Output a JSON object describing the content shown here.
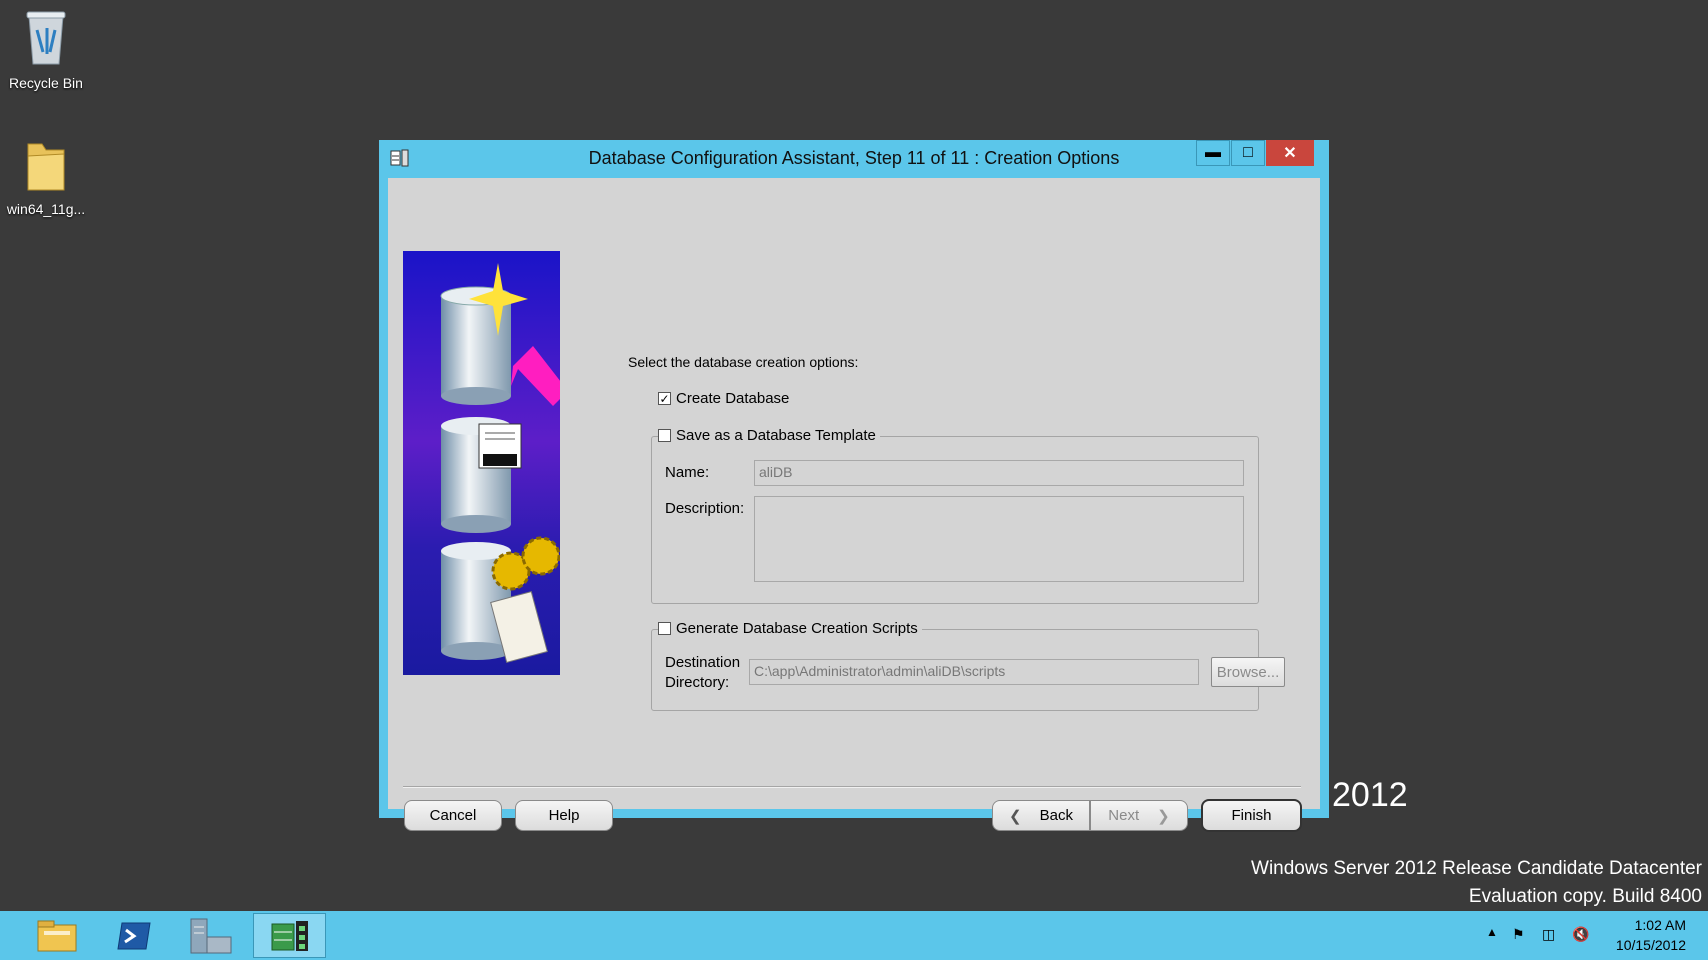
{
  "desktop": {
    "icons": [
      {
        "label": "Recycle Bin"
      },
      {
        "label": "win64_11g..."
      }
    ],
    "brand_year": "2012",
    "watermark_line1": "Windows Server 2012 Release Candidate Datacenter",
    "watermark_line2": "Evaluation copy. Build 8400"
  },
  "dialog": {
    "title": "Database Configuration Assistant, Step 11 of 11 : Creation Options",
    "prompt": "Select the database creation options:",
    "create_database": {
      "label": "Create Database",
      "checked": true
    },
    "save_template": {
      "label": "Save as a Database Template",
      "checked": false,
      "name_label": "Name:",
      "name_value": "aliDB",
      "description_label": "Description:",
      "description_value": ""
    },
    "generate_scripts": {
      "label": "Generate Database Creation Scripts",
      "checked": false,
      "destination_label_1": "Destination",
      "destination_label_2": "Directory:",
      "destination_value": "C:\\app\\Administrator\\admin\\aliDB\\scripts",
      "browse_label": "Browse..."
    },
    "buttons": {
      "cancel": "Cancel",
      "help": "Help",
      "back": "Back",
      "next": "Next",
      "finish": "Finish"
    }
  },
  "taskbar": {
    "time": "1:02 AM",
    "date": "10/15/2012"
  },
  "colors": {
    "accent": "#5bc6ea",
    "close": "#c9463d",
    "dialog_bg": "#d4d4d4",
    "desktop_bg": "#3a3a3a"
  }
}
